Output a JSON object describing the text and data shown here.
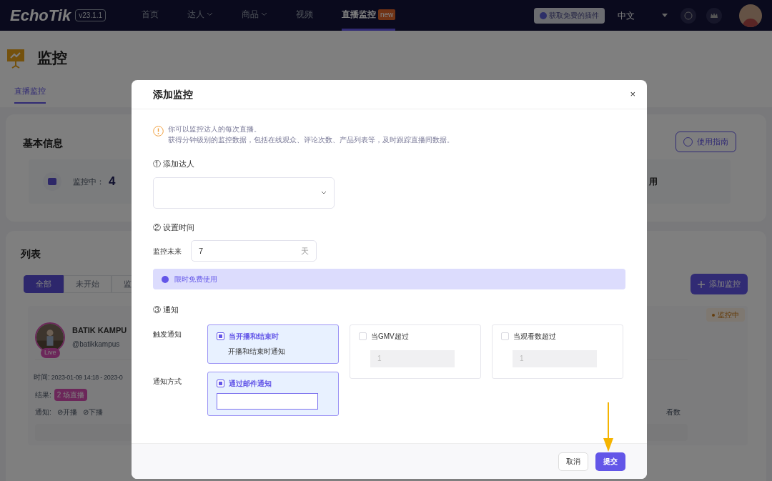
{
  "nav": {
    "logo": "EchoTik",
    "version": "v23.1.1",
    "items": [
      {
        "label": "首页",
        "dropdown": false,
        "selected": false
      },
      {
        "label": "达人",
        "dropdown": true,
        "selected": false
      },
      {
        "label": "商品",
        "dropdown": true,
        "selected": false
      },
      {
        "label": "视频",
        "dropdown": false,
        "selected": false
      },
      {
        "label": "直播监控",
        "dropdown": false,
        "selected": true,
        "badge": "new"
      }
    ],
    "plugin_button": "获取免费的插件",
    "language": "中文"
  },
  "page": {
    "title": "监控",
    "tabs": [
      {
        "label": "直播监控",
        "selected": true
      }
    ],
    "basic_info": {
      "title": "基本信息",
      "stat_label": "监控中：",
      "stat_value": "4",
      "fragment": "用",
      "guide_button": "使用指南"
    },
    "list": {
      "title": "列表",
      "filters": [
        {
          "label": "全部",
          "selected": true
        },
        {
          "label": "未开始",
          "selected": false
        },
        {
          "label": "监",
          "selected": false
        }
      ],
      "add_button": "添加监控",
      "item": {
        "name": "BATIK KAMPU",
        "handle": "@batikkampus",
        "live_badge": "Live",
        "status": "监控中",
        "time_label": "时间:",
        "time_value": "2023-01-09 14:18 - 2023-0",
        "result_label": "结果:",
        "result_value": "2 场直播",
        "notify_label": "通知:",
        "notify_items": [
          "⊘开播",
          "⊘下播"
        ],
        "fragment": "看数"
      }
    }
  },
  "dialog": {
    "title": "添加监控",
    "close": "×",
    "notice": [
      "你可以监控达人的每次直播。",
      "获得分钟级别的监控数据，包括在线观众、评论次数、产品列表等，及时跟踪直播间数据。"
    ],
    "step1": {
      "label": "① 添加达人"
    },
    "step2": {
      "label": "② 设置时间",
      "field_label": "监控未来",
      "value": "7",
      "unit": "天",
      "info": "限时免费使用"
    },
    "step3": {
      "label": "③ 通知",
      "trigger_label": "触发通知",
      "triggers": [
        {
          "kind": "text",
          "title": "当开播和结束时",
          "checked": true,
          "description": "开播和结束时通知"
        },
        {
          "kind": "input",
          "title": "当GMV超过",
          "checked": false,
          "placeholder": "1"
        },
        {
          "kind": "input",
          "title": "当观看数超过",
          "checked": false,
          "placeholder": "1"
        }
      ],
      "method_label": "通知方式",
      "methods": [
        {
          "title": "通过邮件通知",
          "checked": true
        }
      ]
    },
    "buttons": {
      "cancel": "取消",
      "submit": "提交"
    }
  }
}
